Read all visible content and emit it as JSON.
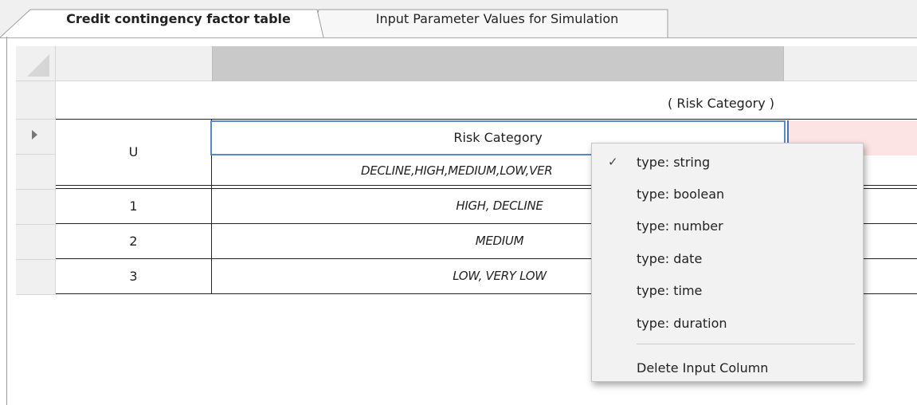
{
  "tabs": [
    {
      "label": "Credit contingency factor table",
      "active": true
    },
    {
      "label": "Input Parameter Values for Simulation",
      "active": false
    }
  ],
  "table": {
    "annotation_header": "( Risk Category )",
    "hit_policy": "U",
    "input_column_label": "Risk Category",
    "input_values_header": "DECLINE,HIGH,MEDIUM,LOW,VER",
    "rows": [
      {
        "number": "1",
        "risk_category": "HIGH, DECLINE"
      },
      {
        "number": "2",
        "risk_category": "MEDIUM"
      },
      {
        "number": "3",
        "risk_category": "LOW, VERY LOW"
      }
    ]
  },
  "context_menu": {
    "checked_icon": "checkmark-icon",
    "check_glyph": "✓",
    "items": [
      {
        "label": "type: string",
        "checked": true
      },
      {
        "label": "type: boolean",
        "checked": false
      },
      {
        "label": "type: number",
        "checked": false
      },
      {
        "label": "type: date",
        "checked": false
      },
      {
        "label": "type: time",
        "checked": false
      },
      {
        "label": "type: duration",
        "checked": false
      }
    ],
    "delete_label": "Delete Input Column"
  },
  "colors": {
    "selection_border": "#5a8ac6",
    "output_cell_fill": "#fce4e4",
    "header_fill": "#c9c9c9",
    "chrome_background": "#f0f0f0"
  }
}
